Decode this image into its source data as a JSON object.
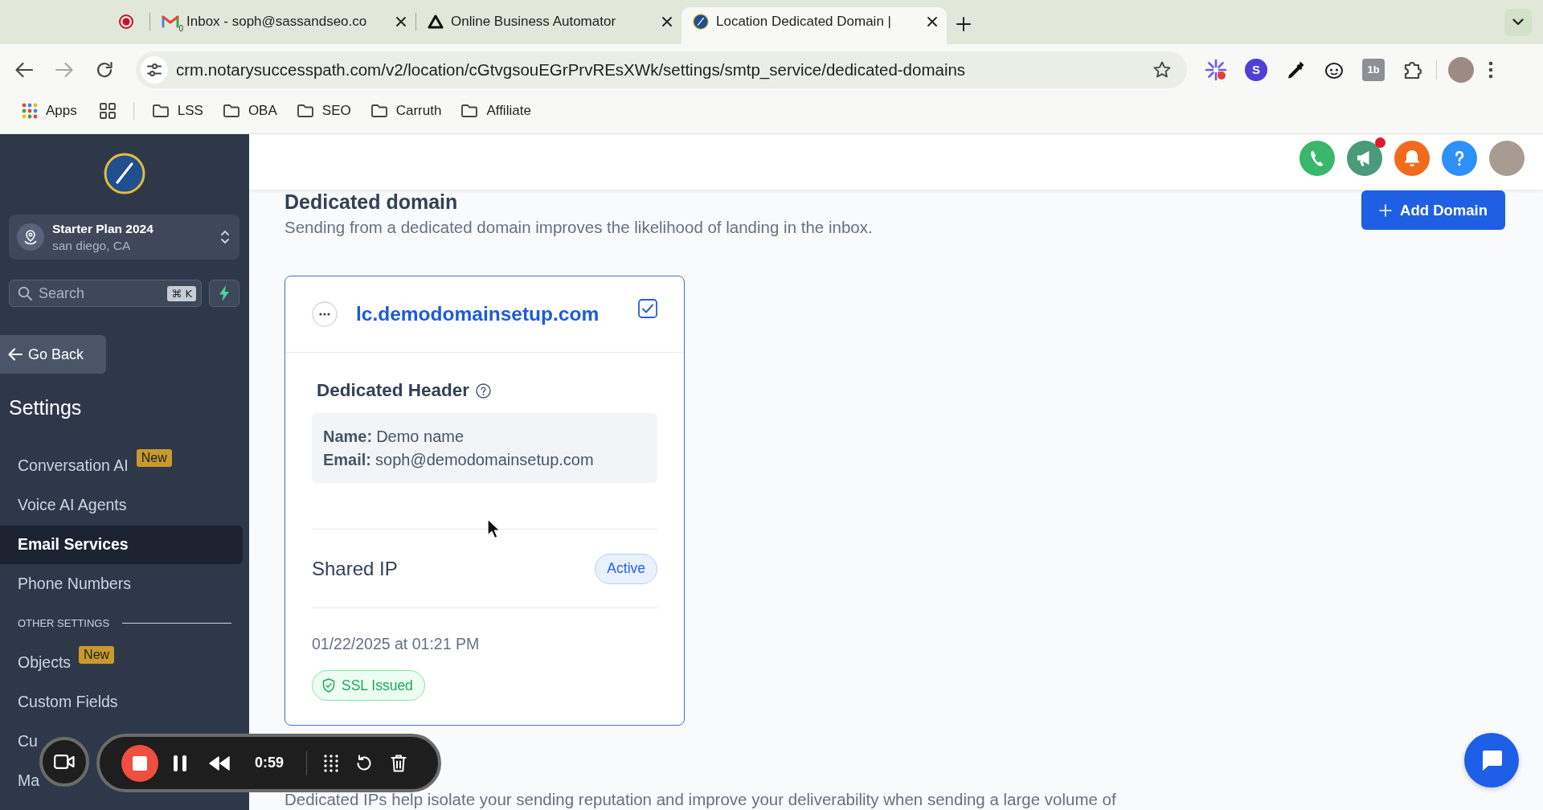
{
  "browser": {
    "tabs": [
      {
        "kind": "pinned",
        "selected": false
      },
      {
        "kind": "mail",
        "title": "Inbox - soph@sassandseo.co",
        "favicon_count": "0",
        "selected": false
      },
      {
        "kind": "triangle",
        "title": "Online Business Automator",
        "selected": false
      },
      {
        "kind": "compass",
        "title": "Location Dedicated Domain |",
        "selected": true
      }
    ],
    "url": "crm.notarysuccesspath.com/v2/location/cGtvgsouEGrPrvREsXWk/settings/smtp_service/dedicated-domains",
    "extensions": [
      {
        "kind": "sparkle"
      },
      {
        "kind": "letter",
        "text": "S"
      },
      {
        "kind": "eyedropper"
      },
      {
        "kind": "face"
      },
      {
        "kind": "tile",
        "text": "1b"
      },
      {
        "kind": "puzzle"
      }
    ],
    "bookmarks": [
      {
        "kind": "apps",
        "label": "Apps"
      },
      {
        "kind": "grid"
      },
      {
        "kind": "folder",
        "label": "LSS"
      },
      {
        "kind": "folder",
        "label": "OBA"
      },
      {
        "kind": "folder",
        "label": "SEO"
      },
      {
        "kind": "folder",
        "label": "Carruth"
      },
      {
        "kind": "folder",
        "label": "Affiliate"
      }
    ]
  },
  "sidebar": {
    "location": {
      "name": "Starter Plan 2024",
      "city": "san diego, CA"
    },
    "search": {
      "placeholder": "Search",
      "shortcut": "⌘ K"
    },
    "back": "Go Back",
    "title": "Settings",
    "items": [
      {
        "kind": "item",
        "label": "Conversation AI",
        "badge": "New",
        "selected": false
      },
      {
        "kind": "item",
        "label": "Voice AI Agents",
        "selected": false
      },
      {
        "kind": "item",
        "label": "Email Services",
        "selected": true
      },
      {
        "kind": "item",
        "label": "Phone Numbers",
        "selected": false
      },
      {
        "kind": "section",
        "label": "OTHER SETTINGS"
      },
      {
        "kind": "item",
        "label": "Objects",
        "badge": "New",
        "selected": false
      },
      {
        "kind": "item",
        "label": "Custom Fields",
        "selected": false
      },
      {
        "kind": "item",
        "label": "Cu",
        "selected": false
      },
      {
        "kind": "item",
        "label": "Ma",
        "selected": false
      }
    ]
  },
  "header": {
    "actions": [
      {
        "kind": "phone",
        "dot": false
      },
      {
        "kind": "megaphone",
        "dot": true
      },
      {
        "kind": "bell",
        "dot": false
      },
      {
        "kind": "help",
        "dot": false
      },
      {
        "kind": "avatar",
        "dot": false
      }
    ]
  },
  "page": {
    "title": "Dedicated domain",
    "description": "Sending from a dedicated domain improves the likelihood of landing in the inbox.",
    "add_button": "Add Domain",
    "domains": [
      {
        "domain": "lc.demodomainsetup.com",
        "checked": true,
        "header_title": "Dedicated Header",
        "fields": [
          {
            "label": "Name:",
            "value": "Demo name"
          },
          {
            "label": "Email:",
            "value": "soph@demodomainsetup.com"
          }
        ],
        "ip_label": "Shared IP",
        "ip_status": "Active",
        "date": "01/22/2025 at 01:21 PM",
        "ssl_status": "SSL Issued"
      }
    ],
    "next_description": "Dedicated IPs help isolate your sending reputation and improve your deliverability when sending a large volume of"
  },
  "recorder": {
    "time": "0:59"
  }
}
